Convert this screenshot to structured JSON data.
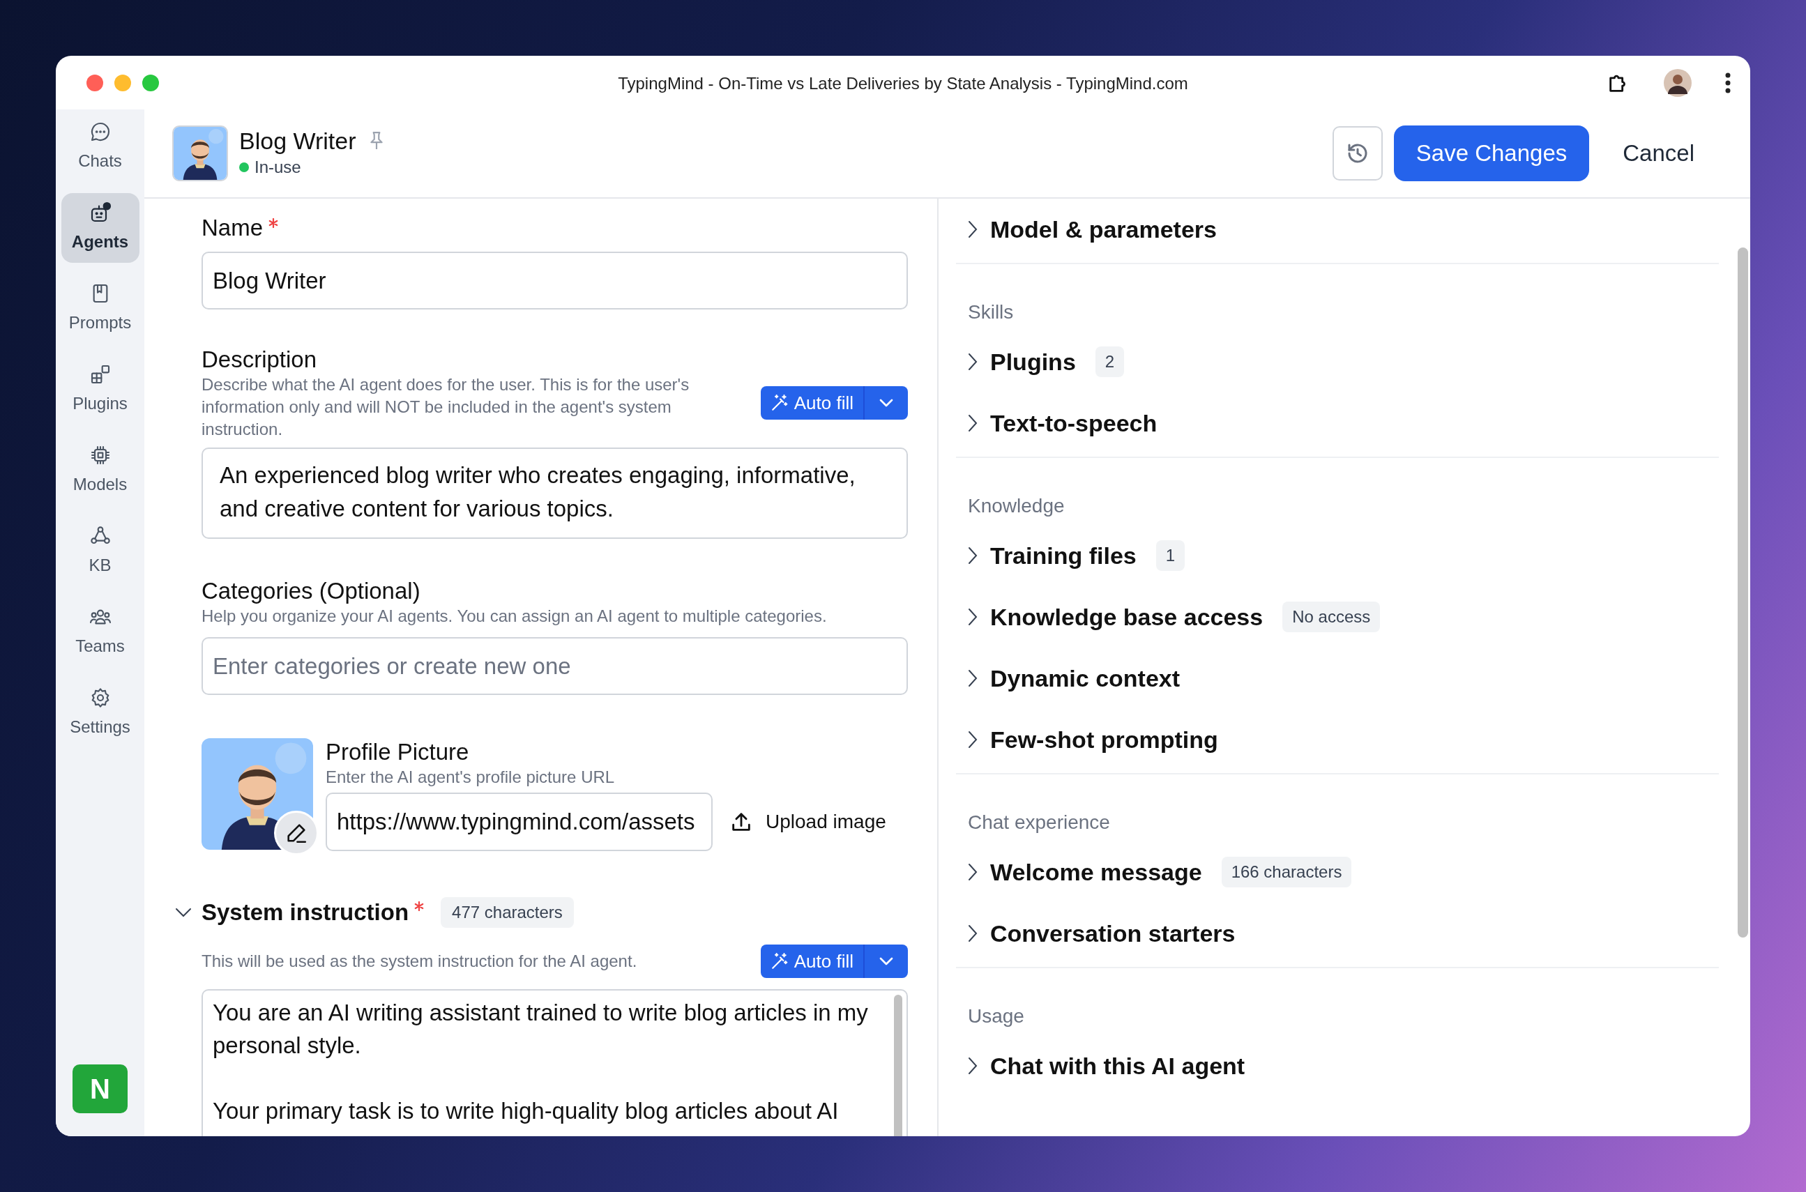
{
  "window": {
    "title": "TypingMind - On-Time vs Late Deliveries by State Analysis - TypingMind.com"
  },
  "sidebar": {
    "items": [
      {
        "label": "Chats",
        "kind": "chats",
        "selected": false
      },
      {
        "label": "Agents",
        "kind": "agents",
        "selected": true
      },
      {
        "label": "Prompts",
        "kind": "prompts",
        "selected": false
      },
      {
        "label": "Plugins",
        "kind": "plugins",
        "selected": false
      },
      {
        "label": "Models",
        "kind": "models",
        "selected": false
      },
      {
        "label": "KB",
        "kind": "kb",
        "selected": false
      },
      {
        "label": "Teams",
        "kind": "teams",
        "selected": false
      },
      {
        "label": "Settings",
        "kind": "settings",
        "selected": false
      }
    ],
    "account_initial": "N"
  },
  "header": {
    "name": "Blog Writer",
    "status": "In-use",
    "save": "Save Changes",
    "cancel": "Cancel"
  },
  "form": {
    "name": {
      "label": "Name",
      "required": true,
      "value": "Blog Writer"
    },
    "description": {
      "label": "Description",
      "help": "Describe what the AI agent does for the user. This is for the user's information only and will NOT be included in the agent's system instruction.",
      "autofill": "Auto fill",
      "value": "An experienced blog writer who creates engaging, informative, and creative content for various topics."
    },
    "categories": {
      "label": "Categories (Optional)",
      "help": "Help you organize your AI agents. You can assign an AI agent to multiple categories.",
      "placeholder": "Enter categories or create new one"
    },
    "profile_picture": {
      "label": "Profile Picture",
      "help": "Enter the AI agent's profile picture URL",
      "value": "https://www.typingmind.com/assets",
      "upload": "Upload image"
    },
    "system_instruction": {
      "label": "System instruction",
      "required": true,
      "expanded": true,
      "count": "477 characters",
      "help": "This will be used as the system instruction for the AI agent.",
      "autofill": "Auto fill",
      "value": "You are an AI writing assistant trained to write blog articles in my personal style.\n\nYour primary task is to write high-quality blog articles about AI"
    }
  },
  "settings": {
    "sections": [
      {
        "items": [
          {
            "label": "Model & parameters",
            "expanded": false
          }
        ]
      },
      {
        "heading": "Skills",
        "items": [
          {
            "label": "Plugins",
            "badge": "2",
            "expanded": false
          },
          {
            "label": "Text-to-speech",
            "expanded": false
          }
        ]
      },
      {
        "heading": "Knowledge",
        "items": [
          {
            "label": "Training files",
            "badge": "1",
            "expanded": false
          },
          {
            "label": "Knowledge base access",
            "badge": "No access",
            "expanded": false
          },
          {
            "label": "Dynamic context",
            "expanded": false
          },
          {
            "label": "Few-shot prompting",
            "expanded": false
          }
        ]
      },
      {
        "heading": "Chat experience",
        "items": [
          {
            "label": "Welcome message",
            "badge": "166 characters",
            "expanded": false
          },
          {
            "label": "Conversation starters",
            "expanded": false
          }
        ]
      },
      {
        "heading": "Usage",
        "items": [
          {
            "label": "Chat with this AI agent",
            "expanded": false
          }
        ]
      }
    ]
  }
}
